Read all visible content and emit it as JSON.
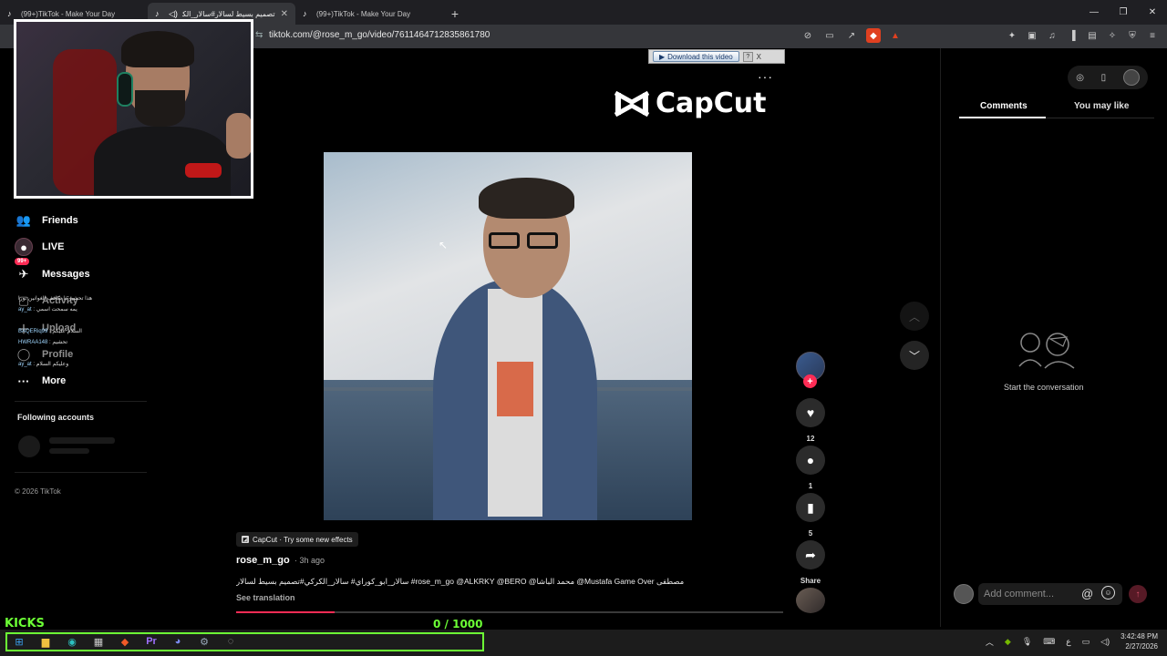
{
  "browser": {
    "tabs": [
      {
        "title": "(99+)TikTok - Make Your Day",
        "active": false
      },
      {
        "title": "تصميم بسيط لسالار#سالار_الكر",
        "active": true
      },
      {
        "title": "(99+)TikTok - Make Your Day",
        "active": false
      }
    ],
    "new_tab": "+",
    "url": "tiktok.com/@rose_m_go/video/7611464712835861780"
  },
  "downloader": {
    "label": "Download this video",
    "help": "?",
    "close": "X"
  },
  "leftnav": {
    "items": [
      {
        "label": "Friends",
        "icon": "friends-icon"
      },
      {
        "label": "LIVE",
        "icon": "live-icon"
      },
      {
        "label": "Messages",
        "icon": "messages-icon",
        "badge": "99+"
      },
      {
        "label": "Activity",
        "icon": "activity-icon"
      },
      {
        "label": "Upload",
        "icon": "upload-icon"
      },
      {
        "label": "Profile",
        "icon": "profile-icon"
      },
      {
        "label": "More",
        "icon": "more-icon"
      }
    ],
    "following_title": "Following accounts",
    "copyright": "© 2026 TikTok"
  },
  "chat_overlay": [
    {
      "user": "",
      "text": "هذا تحشير ذا تكافف الغوانين نورا"
    },
    {
      "user": "ay_at",
      "text": ": يمه سمحت اسمي"
    },
    {
      "user": "BAQERiq99",
      "text": ": السلام عليكم"
    },
    {
      "user": "HWRAA148",
      "text": ": تحشيم"
    },
    {
      "user": "ay_at",
      "text": ": وعليكم السلام"
    }
  ],
  "video": {
    "brand": "CapCut",
    "more_label": "···",
    "likes": "12",
    "comments": "1",
    "saves": "5",
    "share_label": "Share",
    "progress": 0.18
  },
  "caption": {
    "effect_tag": "CapCut · Try some new effects",
    "author": "rose_m_go",
    "time_ago": "· 3h ago",
    "text": "سالار_ابو_كوراي# سالار_الكركي#تصميم بسيط لسالار #rose_m_go @ALKRKY @BERO @محمد الباشا @Mustafa Game Over مصطفى",
    "see_translation": "See translation"
  },
  "comments_panel": {
    "tab_comments": "Comments",
    "tab_you_may_like": "You may like",
    "empty_text": "Start the conversation",
    "input_placeholder": "Add comment...",
    "at_symbol": "@"
  },
  "overlay": {
    "kicks_label": "KICKS",
    "kicks_count": "0  / 1000"
  },
  "taskbar": {
    "time": "3:42:48 PM",
    "date": "2/27/2026",
    "lang": "ع"
  },
  "colors": {
    "accent": "#fe2c55",
    "kicks": "#6cff35"
  }
}
